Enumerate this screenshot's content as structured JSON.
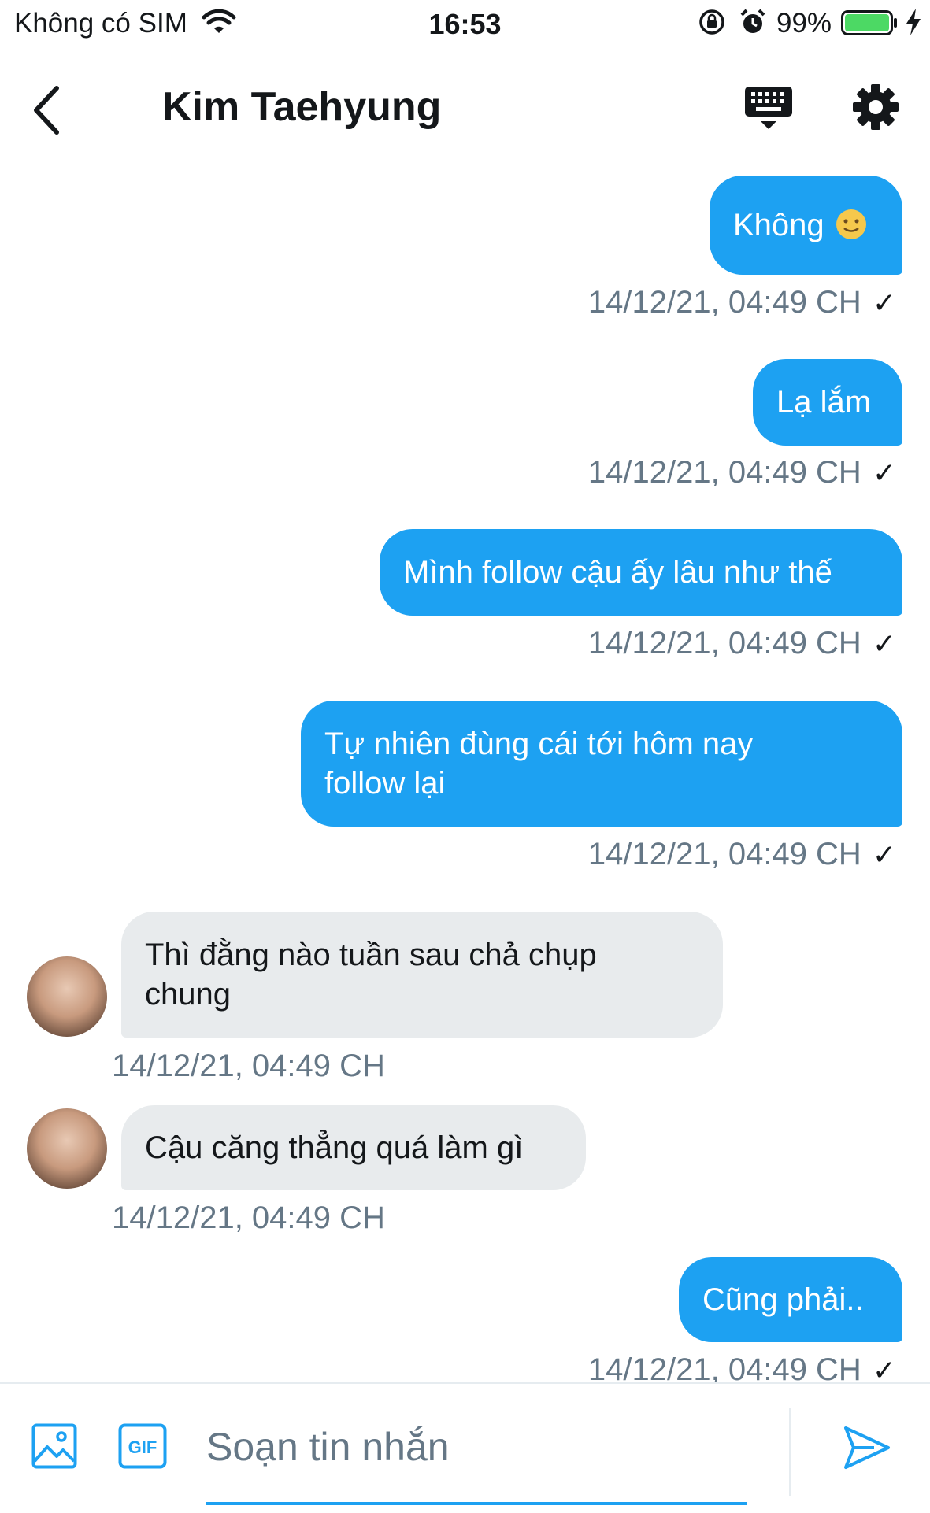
{
  "status_bar": {
    "carrier": "Không có SIM",
    "time": "16:53",
    "battery": "99%"
  },
  "header": {
    "title": "Kim Taehyung"
  },
  "messages": [
    {
      "dir": "out",
      "text": "Không",
      "emoji": "slight-smile-emoji",
      "time": "14/12/21, 04:49 CH",
      "read": "✓"
    },
    {
      "dir": "out",
      "text": "Lạ lắm",
      "time": "14/12/21, 04:49 CH",
      "read": "✓"
    },
    {
      "dir": "out",
      "text": "Mình follow cậu ấy lâu như thế",
      "time": "14/12/21, 04:49 CH",
      "read": "✓"
    },
    {
      "dir": "out",
      "text_line1": "Tự nhiên đùng cái tới hôm nay",
      "text_line2": "follow lại",
      "time": "14/12/21, 04:49 CH",
      "read": "✓"
    },
    {
      "dir": "in",
      "text_line1": "Thì đằng nào tuần sau chả chụp",
      "text_line2": "chung",
      "time": "14/12/21, 04:49 CH"
    },
    {
      "dir": "in",
      "text": "Cậu căng thẳng quá làm gì",
      "time": "14/12/21, 04:49 CH"
    },
    {
      "dir": "out",
      "text": "Cũng phải..",
      "time": "14/12/21, 04:49 CH",
      "read": "✓"
    }
  ],
  "composer": {
    "placeholder": "Soạn tin nhắn",
    "gif_label": "GIF"
  },
  "colors": {
    "accent": "#1da1f2",
    "incoming_bubble": "#e8ebed",
    "timestamp": "#657786",
    "battery": "#4cd964"
  }
}
